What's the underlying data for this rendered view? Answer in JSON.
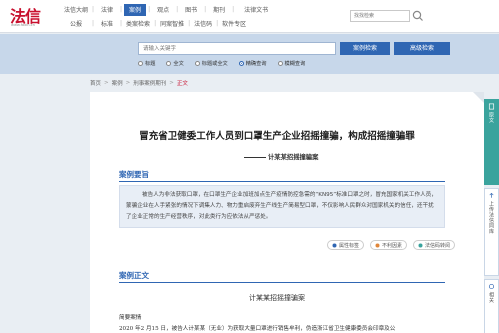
{
  "logo": {
    "text": "法信",
    "url": "www.faxin.cn"
  },
  "nav": {
    "rows": [
      [
        "法信大纲",
        "法律",
        "案例",
        "观点",
        "图书",
        "期刊",
        "法律文书"
      ],
      [
        "公报",
        "标准",
        "类案检索",
        "同案智推",
        "法信码",
        "软件专区"
      ]
    ],
    "active": "案例"
  },
  "top_search": {
    "placeholder": "找找检索"
  },
  "search": {
    "placeholder": "请输入关键字",
    "search_button": "案例检索",
    "advanced_button": "高级检索",
    "options": [
      {
        "label": "标题",
        "selected": false
      },
      {
        "label": "全文",
        "selected": false
      },
      {
        "label": "标题或全文",
        "selected": false
      },
      {
        "label": "精确查询",
        "selected": true
      },
      {
        "label": "模糊查询",
        "selected": false
      }
    ]
  },
  "breadcrumb": [
    "首页",
    "案例",
    "刑事案例期刊",
    "正文"
  ],
  "article": {
    "title": "冒充省卫健委工作人员到口罩生产企业招摇撞骗，构成招摇撞骗罪",
    "subtitle": "计某某招摇撞骗案",
    "summary_heading": "案例要旨",
    "summary": "被告人为非法获取口罩，在口罩生产企业加班加点生产疫情防控急需的“KN95”标准口罩之时，冒充国家机关工作人员，蒙骗企业在人手紧张的情况下调集人力、物力重启废弃生产线生产简易型口罩，不仅影响人民群众对国家机关的信任，还干扰了企业正常的生产经营秩序，对此类行为应依法从严惩处。",
    "actions": [
      "属性标签",
      "不利因素",
      "法信码转阅"
    ],
    "body_heading": "案例正文",
    "doc_title": "计某某招摇撞骗案",
    "doc_label": "简要案情",
    "doc_first_line": "2020 年2 月15 日，被告人计某某（无业）为获取大量口罩进行销售牟利，伪造浙江省卫生健康委员会印章及公"
  },
  "side_tabs": [
    {
      "label": "原文",
      "icon": "document-icon"
    },
    {
      "label": "上传法信同库",
      "icon": "upload-icon"
    },
    {
      "label": "相关",
      "icon": "link-icon"
    }
  ],
  "colors": {
    "accent": "#2f66b3",
    "brand": "#c8102e",
    "side_active": "#3aa39d"
  }
}
